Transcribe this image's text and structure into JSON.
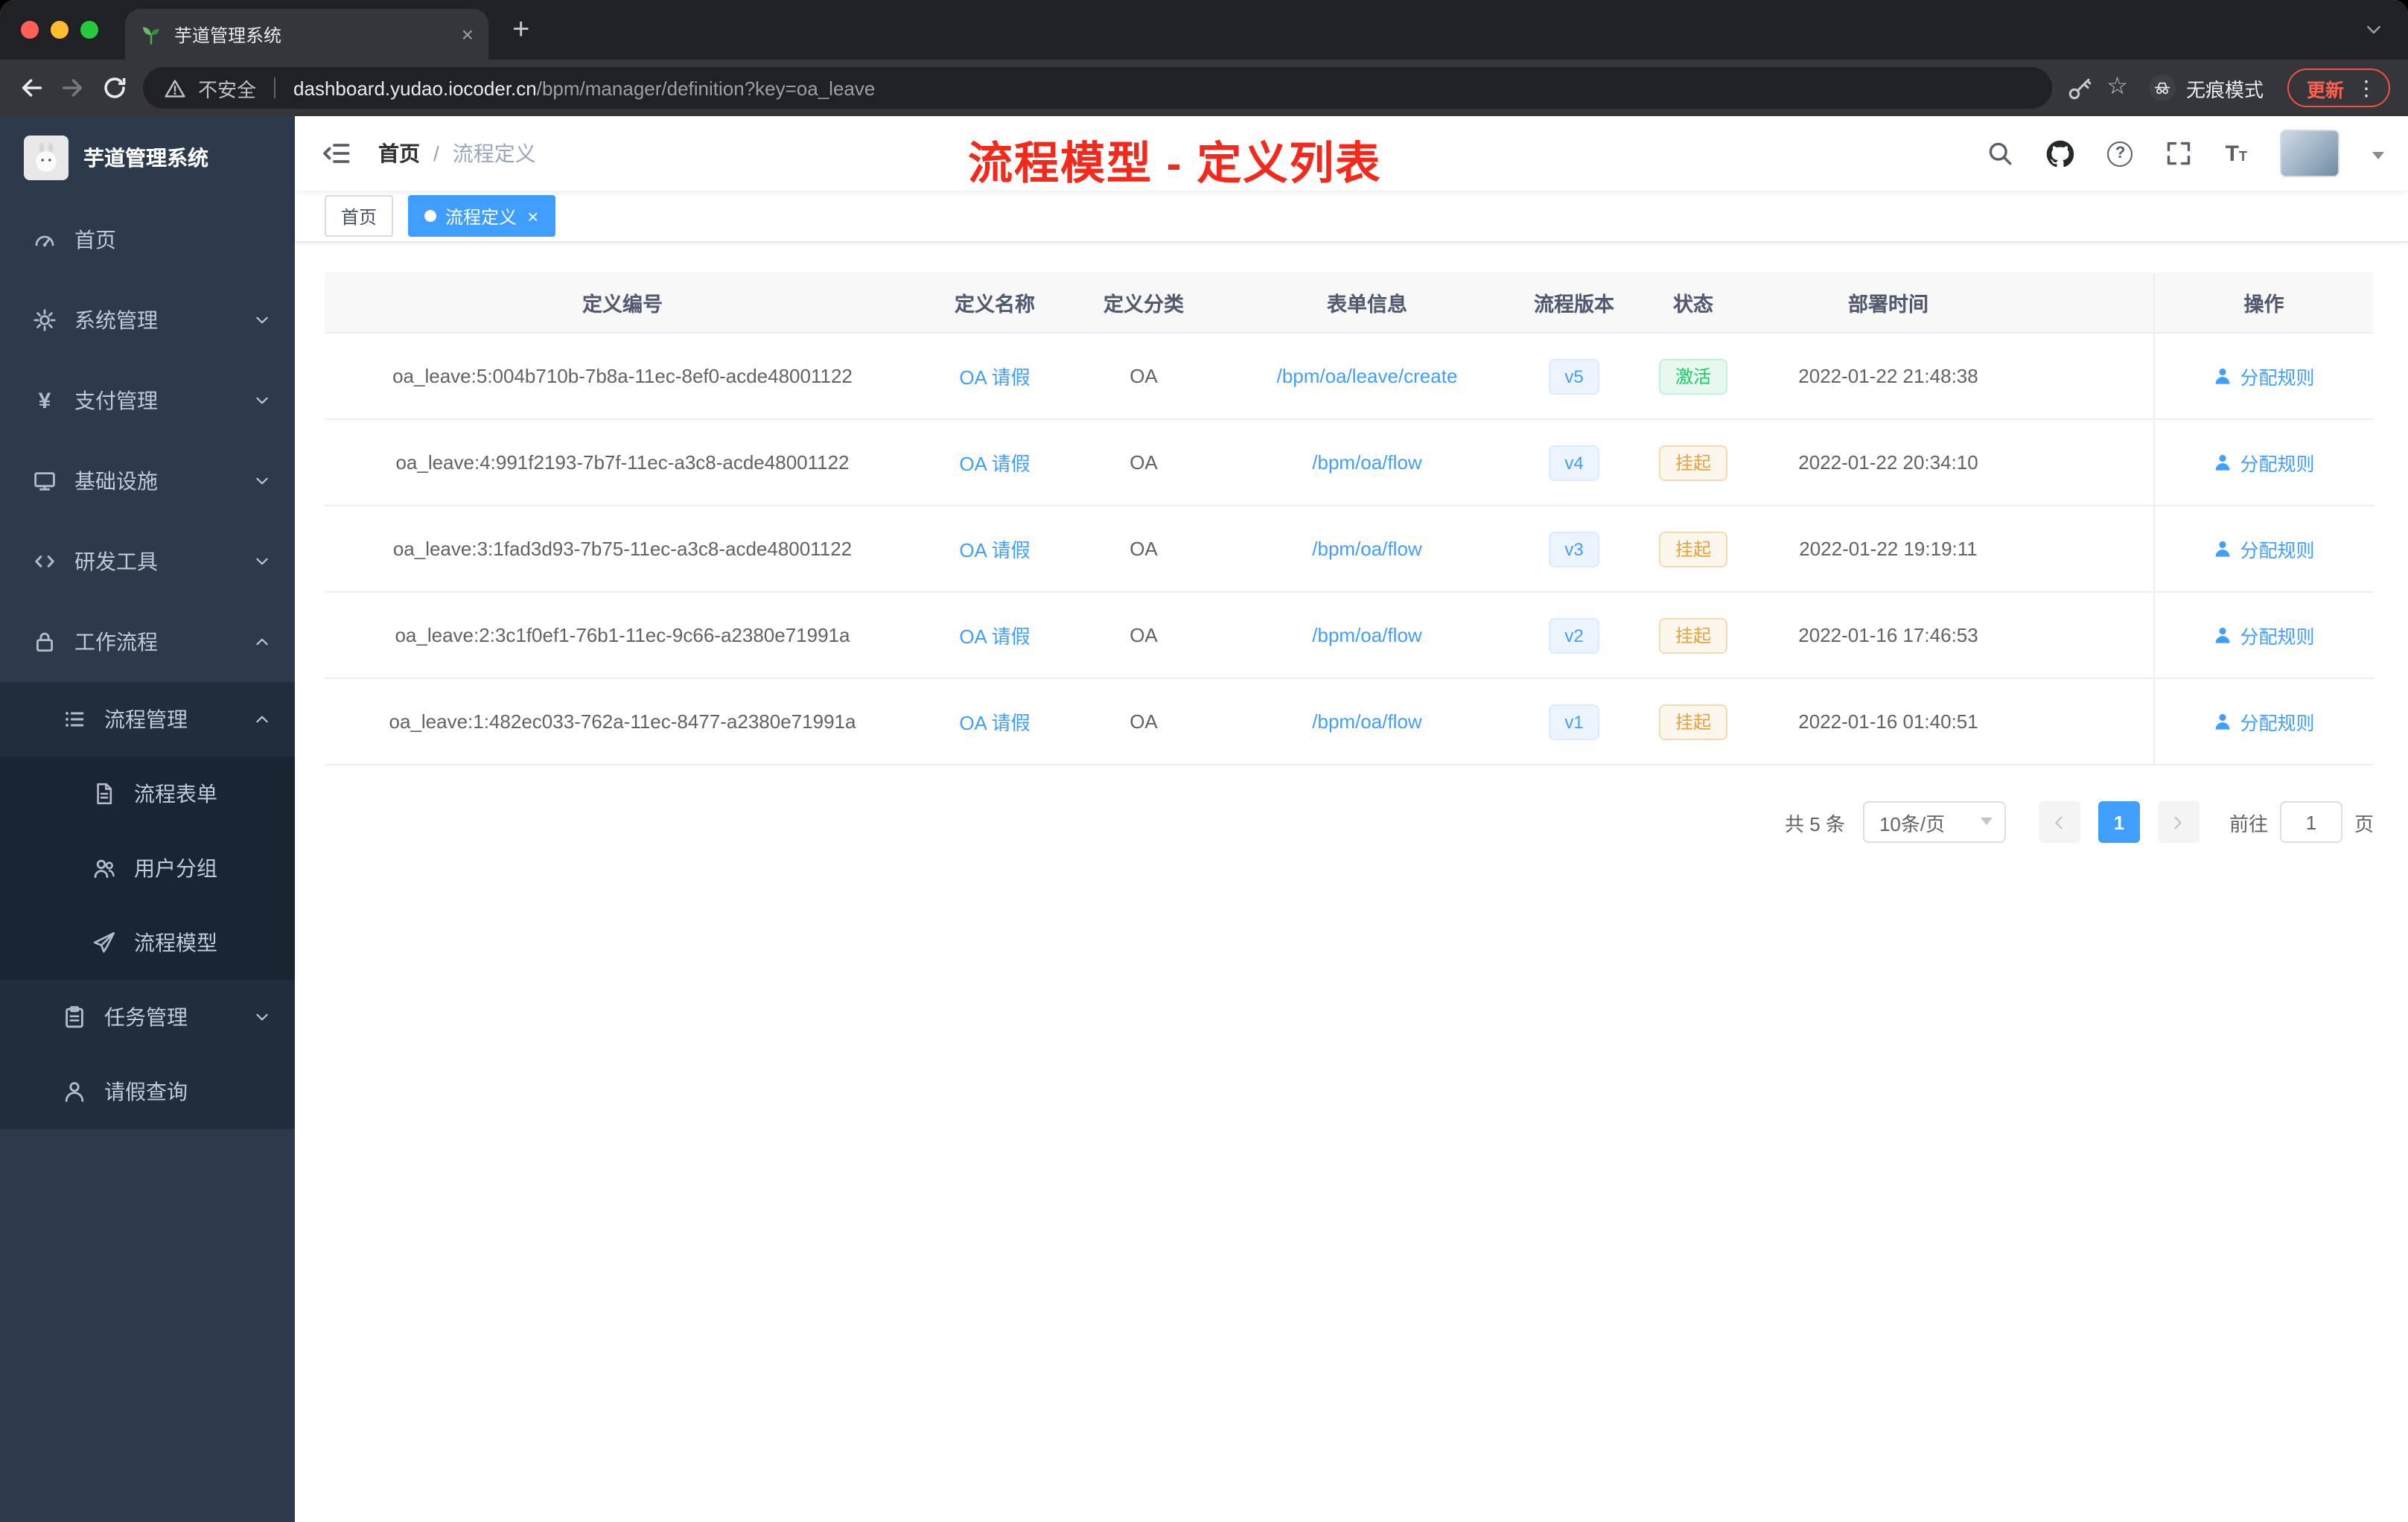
{
  "browser": {
    "tab_title": "芋道管理系统",
    "address": {
      "security": "不安全",
      "host": "dashboard.yudao.iocoder.cn",
      "path": "/bpm/manager/definition?key=oa_leave",
      "incognito": "无痕模式",
      "update": "更新"
    }
  },
  "icons": {
    "close": "×",
    "new_tab": "+",
    "more": "⋮",
    "star": "☆",
    "question": "?",
    "font_big": "T",
    "font_small": "T"
  },
  "colors": {
    "accent": "#409eff",
    "success": "#13ce66",
    "warning": "#e6a23c",
    "annotation_red": "#f3291c",
    "sidebar_bg": "#2d3a4b"
  },
  "sidebar": {
    "title": "芋道管理系统",
    "items": [
      {
        "label": "首页"
      },
      {
        "label": "系统管理"
      },
      {
        "label": "支付管理"
      },
      {
        "label": "基础设施"
      },
      {
        "label": "研发工具"
      },
      {
        "label": "工作流程"
      },
      {
        "label": "流程管理"
      },
      {
        "label": "流程表单"
      },
      {
        "label": "用户分组"
      },
      {
        "label": "流程模型"
      },
      {
        "label": "任务管理"
      },
      {
        "label": "请假查询"
      }
    ]
  },
  "navbar": {
    "breadcrumb_home": "首页",
    "breadcrumb_separator": "/",
    "breadcrumb_current": "流程定义",
    "annotation": "流程模型 - 定义列表"
  },
  "tags": {
    "home": "首页",
    "active": "流程定义"
  },
  "table": {
    "columns": [
      "定义编号",
      "定义名称",
      "定义分类",
      "表单信息",
      "流程版本",
      "状态",
      "部署时间",
      "操作"
    ],
    "rows": [
      {
        "id": "oa_leave:5:004b710b-7b8a-11ec-8ef0-acde48001122",
        "name": "OA 请假",
        "category": "OA",
        "form": "/bpm/oa/leave/create",
        "version": "v5",
        "status": "激活",
        "time": "2022-01-22 21:48:38",
        "action": "分配规则"
      },
      {
        "id": "oa_leave:4:991f2193-7b7f-11ec-a3c8-acde48001122",
        "name": "OA 请假",
        "category": "OA",
        "form": "/bpm/oa/flow",
        "version": "v4",
        "status": "挂起",
        "time": "2022-01-22 20:34:10",
        "action": "分配规则"
      },
      {
        "id": "oa_leave:3:1fad3d93-7b75-11ec-a3c8-acde48001122",
        "name": "OA 请假",
        "category": "OA",
        "form": "/bpm/oa/flow",
        "version": "v3",
        "status": "挂起",
        "time": "2022-01-22 19:19:11",
        "action": "分配规则"
      },
      {
        "id": "oa_leave:2:3c1f0ef1-76b1-11ec-9c66-a2380e71991a",
        "name": "OA 请假",
        "category": "OA",
        "form": "/bpm/oa/flow",
        "version": "v2",
        "status": "挂起",
        "time": "2022-01-16 17:46:53",
        "action": "分配规则"
      },
      {
        "id": "oa_leave:1:482ec033-762a-11ec-8477-a2380e71991a",
        "name": "OA 请假",
        "category": "OA",
        "form": "/bpm/oa/flow",
        "version": "v1",
        "status": "挂起",
        "time": "2022-01-16 01:40:51",
        "action": "分配规则"
      }
    ]
  },
  "pagination": {
    "total": "共 5 条",
    "page_size": "10条/页",
    "current_page": "1",
    "goto_label": "前往",
    "goto_value": "1",
    "page_unit": "页"
  }
}
